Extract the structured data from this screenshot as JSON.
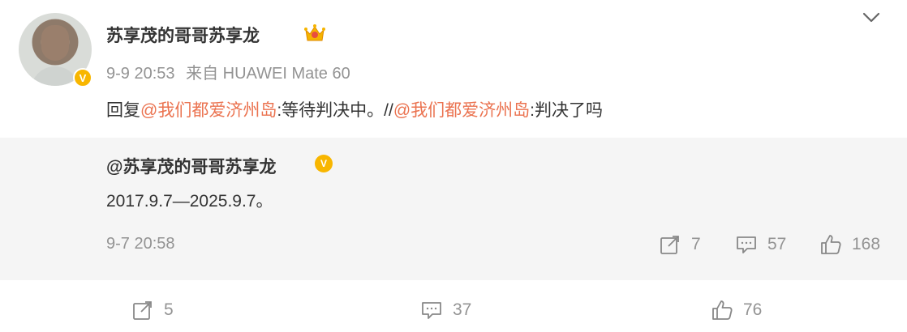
{
  "post": {
    "author": "苏享茂的哥哥苏享龙",
    "time": "9-9 20:53",
    "source": "来自 HUAWEI Mate 60",
    "content": {
      "prefix": "回复",
      "mention1": "@我们都爱济州岛",
      "text1": ":等待判决中。//",
      "mention2": "@我们都爱济州岛",
      "text2": ":判决了吗"
    },
    "badges": {
      "verified": "V",
      "crown_icon": "crown-icon"
    }
  },
  "original": {
    "author": "@苏享茂的哥哥苏享龙",
    "verified": "V",
    "text": "2017.9.7—2025.9.7。",
    "time": "9-7 20:58",
    "actions": {
      "repost": "7",
      "comment": "57",
      "like": "168"
    }
  },
  "actions": {
    "repost": "5",
    "comment": "37",
    "like": "76"
  },
  "colors": {
    "mention": "#eb7350",
    "meta": "#939393",
    "verified": "#f8b600",
    "repost_bg": "#f5f5f5"
  }
}
